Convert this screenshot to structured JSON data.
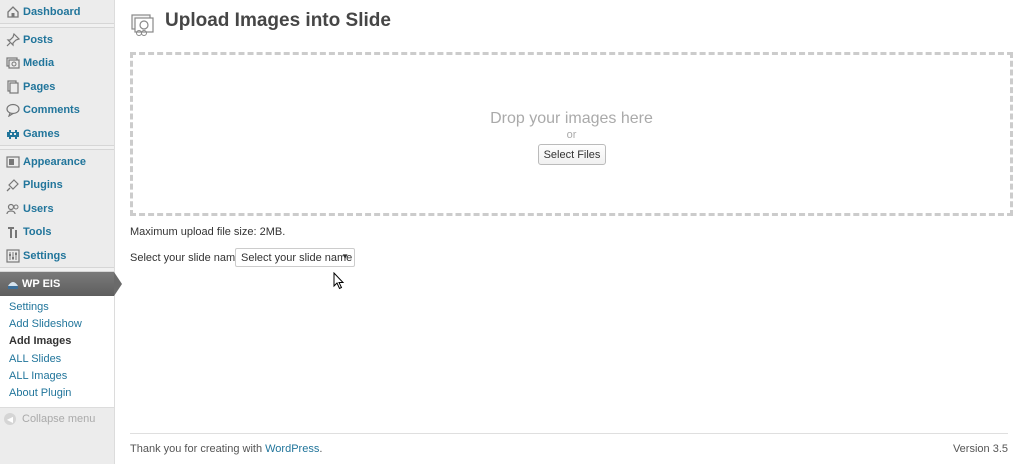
{
  "sidebar": {
    "items": [
      {
        "label": "Dashboard",
        "icon": "dashboard-icon"
      },
      {
        "label": "Posts",
        "icon": "pushpin-icon"
      },
      {
        "label": "Media",
        "icon": "media-icon"
      },
      {
        "label": "Pages",
        "icon": "pages-icon"
      },
      {
        "label": "Comments",
        "icon": "comment-icon"
      },
      {
        "label": "Games",
        "icon": "invader-icon"
      },
      {
        "label": "Appearance",
        "icon": "appearance-icon"
      },
      {
        "label": "Plugins",
        "icon": "plug-icon"
      },
      {
        "label": "Users",
        "icon": "users-icon"
      },
      {
        "label": "Tools",
        "icon": "tools-icon"
      },
      {
        "label": "Settings",
        "icon": "settings-icon"
      }
    ],
    "active": {
      "label": "WP EIS",
      "icon": "plugin-icon"
    },
    "submenu": [
      {
        "label": "Settings"
      },
      {
        "label": "Add Slideshow"
      },
      {
        "label": "Add Images"
      },
      {
        "label": "ALL Slides"
      },
      {
        "label": "ALL Images"
      },
      {
        "label": "About Plugin"
      }
    ],
    "collapse_label": "Collapse menu"
  },
  "main": {
    "title": "Upload Images into Slide",
    "drop_text": "Drop your images here",
    "or_text": "or",
    "select_files_label": "Select Files",
    "max_upload": "Maximum upload file size: 2MB.",
    "slide_label": "Select your slide name :",
    "slide_select_value": "Select your slide name"
  },
  "footer": {
    "prefix": "Thank you for creating with ",
    "link": "WordPress",
    "suffix": ".",
    "version": "Version 3.5"
  },
  "colors": {
    "link": "#21759b",
    "active_bg": "#6a6a6a"
  }
}
